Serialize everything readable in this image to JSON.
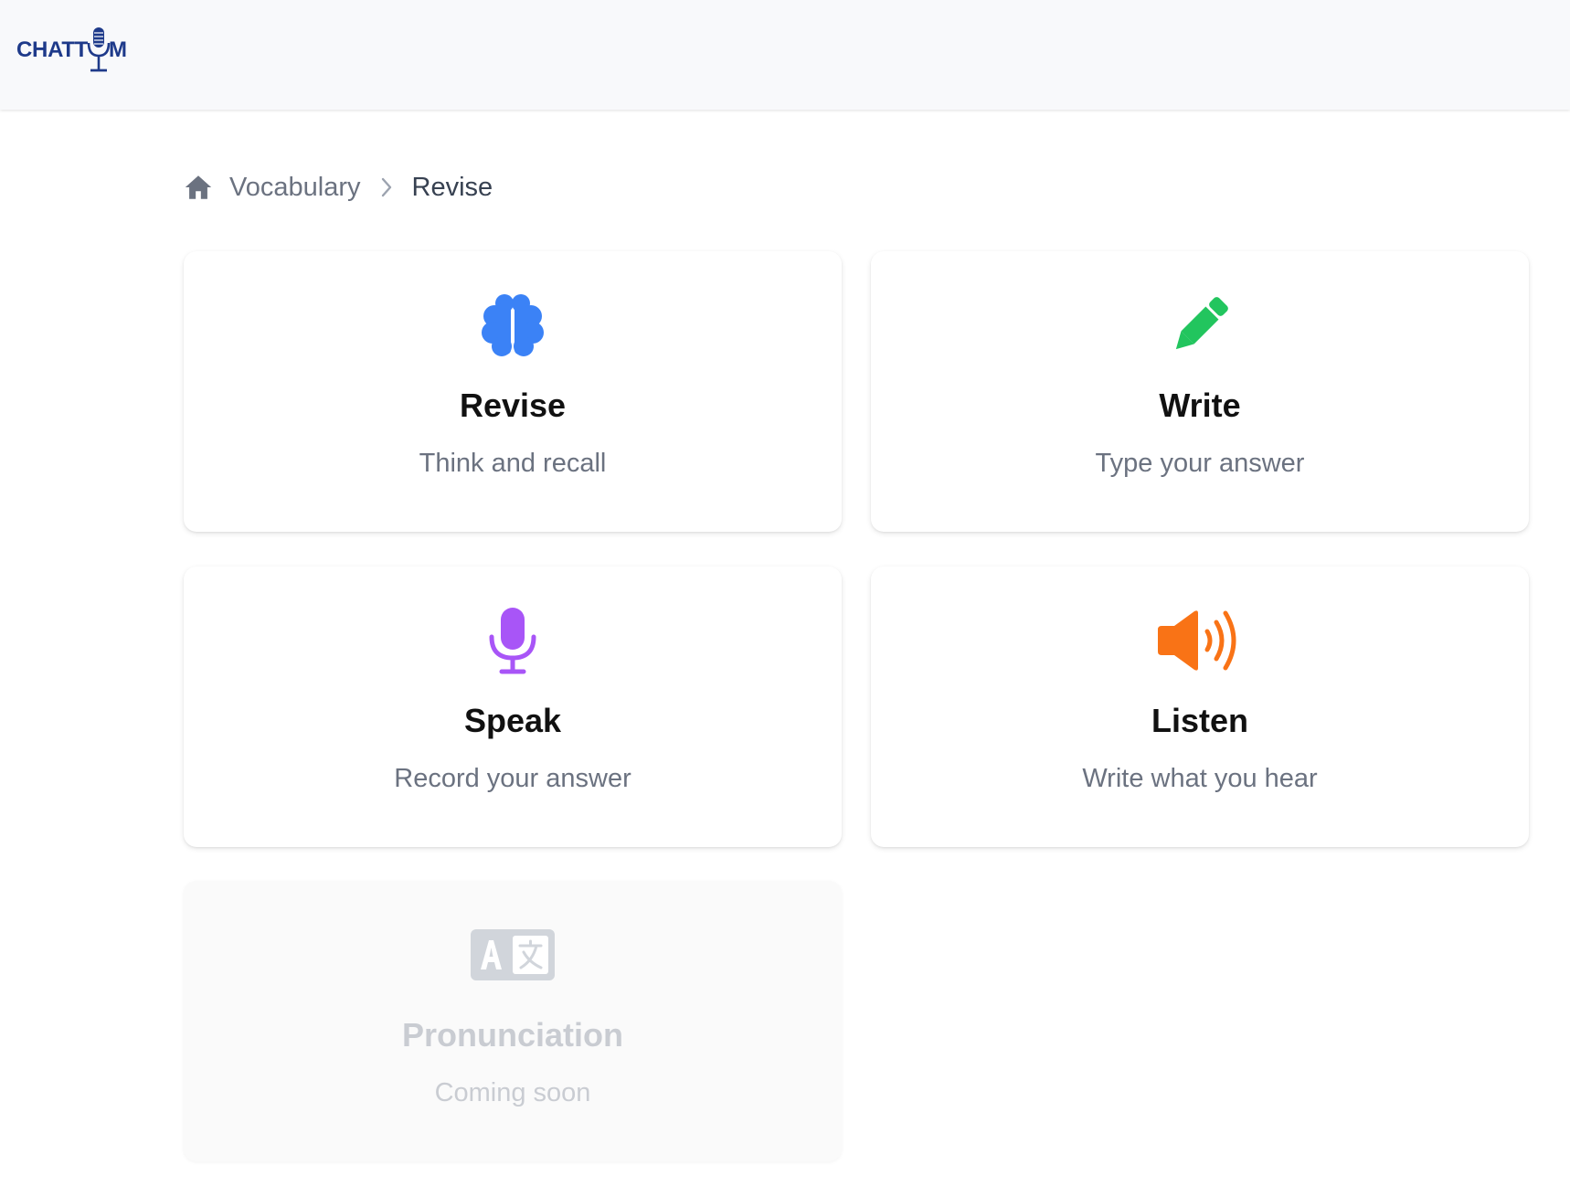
{
  "header": {
    "logo_text_left": "CHATT",
    "logo_text_right": "M"
  },
  "breadcrumb": {
    "items": [
      "Vocabulary",
      "Revise"
    ]
  },
  "cards": [
    {
      "title": "Revise",
      "subtitle": "Think and recall",
      "icon": "brain-icon",
      "color": "#3b82f6",
      "enabled": true
    },
    {
      "title": "Write",
      "subtitle": "Type your answer",
      "icon": "pencil-icon",
      "color": "#22c55e",
      "enabled": true
    },
    {
      "title": "Speak",
      "subtitle": "Record your answer",
      "icon": "microphone-icon",
      "color": "#a855f7",
      "enabled": true
    },
    {
      "title": "Listen",
      "subtitle": "Write what you hear",
      "icon": "speaker-icon",
      "color": "#f97316",
      "enabled": true
    },
    {
      "title": "Pronunciation",
      "subtitle": "Coming soon",
      "icon": "translate-icon",
      "color": "#d1d5db",
      "enabled": false
    }
  ]
}
